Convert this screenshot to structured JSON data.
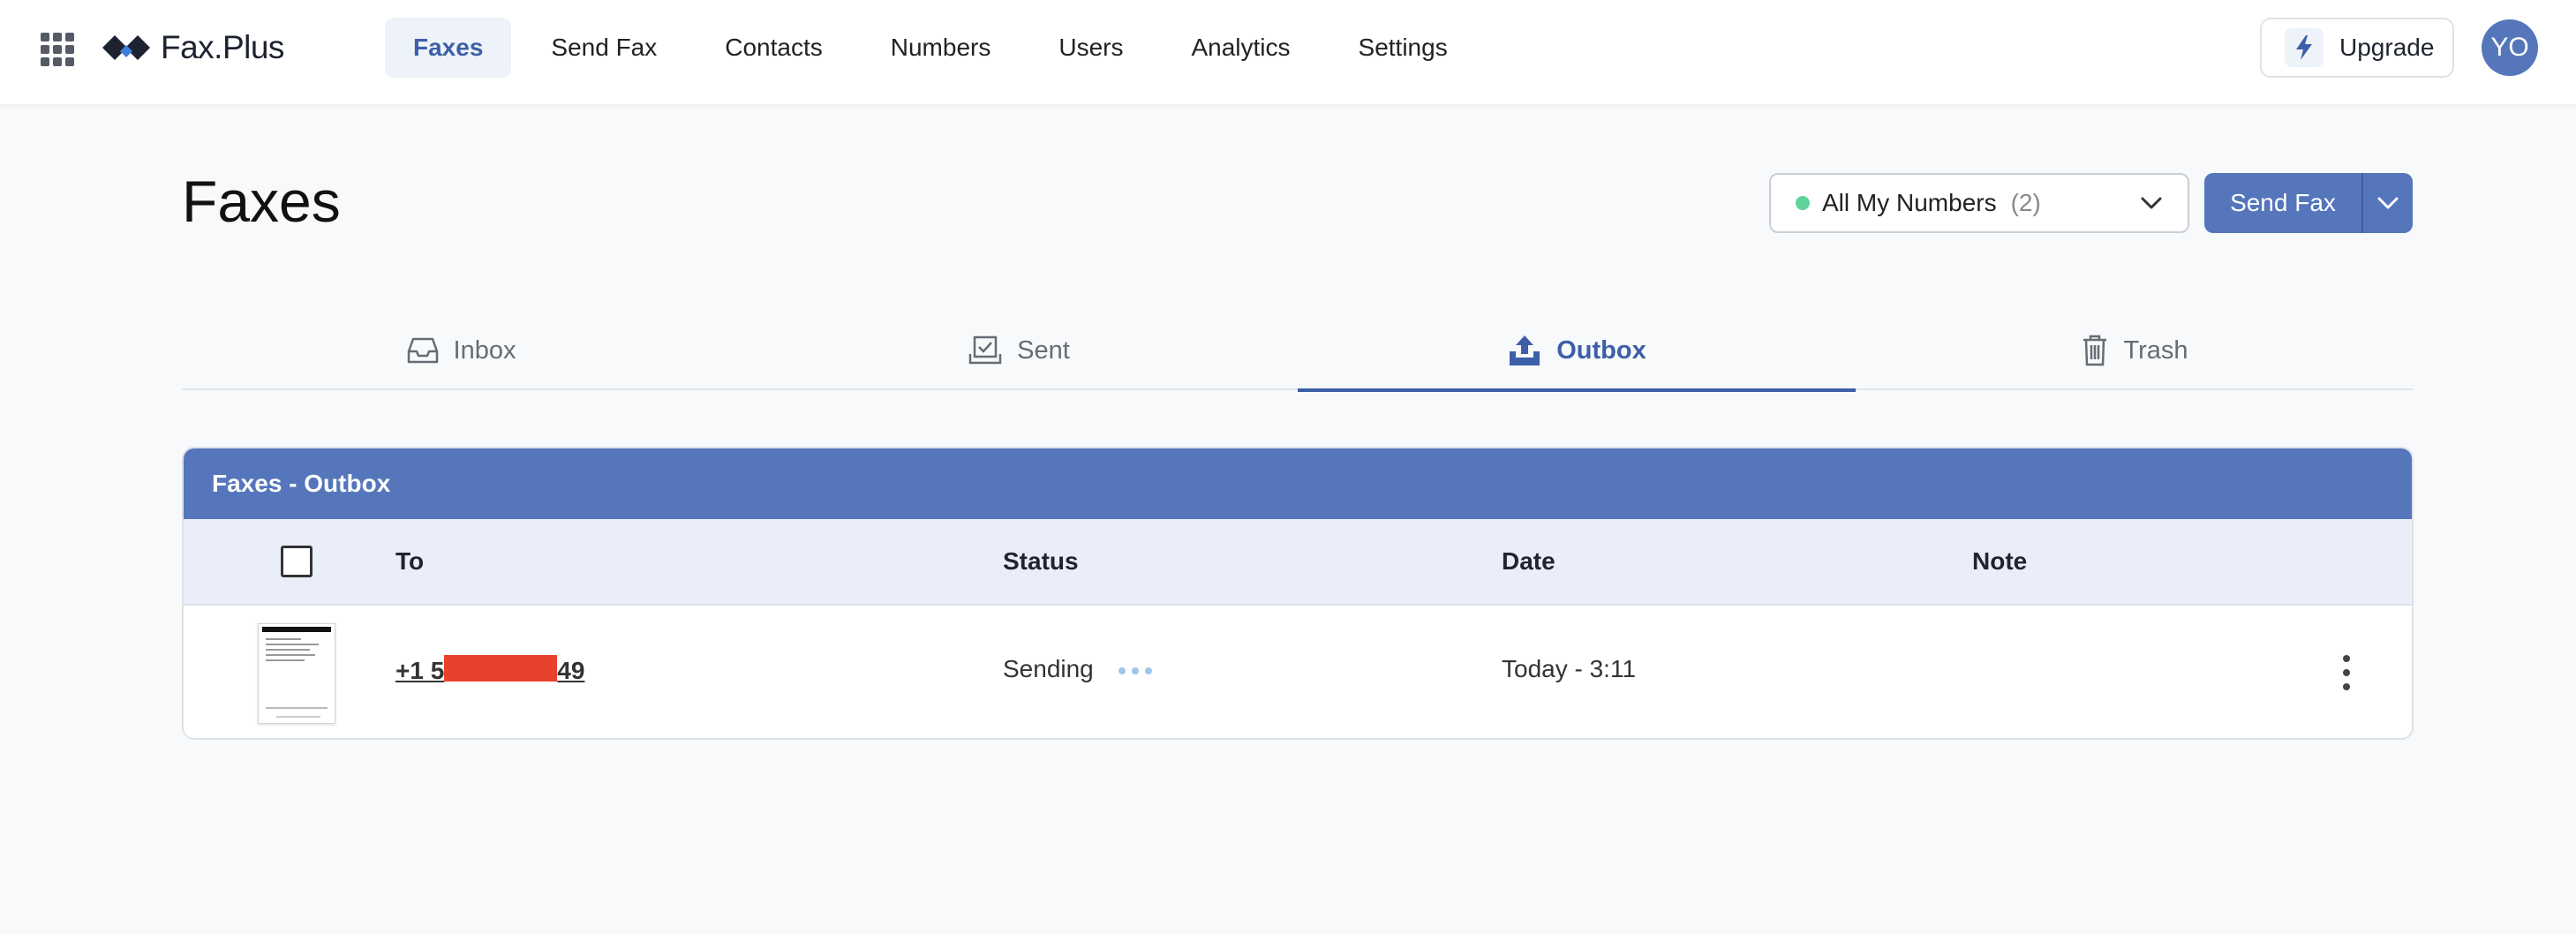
{
  "app": {
    "name": "Fax.Plus"
  },
  "nav": {
    "items": [
      {
        "label": "Faxes",
        "active": true
      },
      {
        "label": "Send Fax",
        "active": false
      },
      {
        "label": "Contacts",
        "active": false
      },
      {
        "label": "Numbers",
        "active": false
      },
      {
        "label": "Users",
        "active": false
      },
      {
        "label": "Analytics",
        "active": false
      },
      {
        "label": "Settings",
        "active": false
      }
    ],
    "upgrade_label": "Upgrade",
    "avatar_initials": "YO"
  },
  "page": {
    "title": "Faxes",
    "number_filter": {
      "label": "All My Numbers",
      "count": "(2)"
    },
    "send_fax_label": "Send Fax"
  },
  "tabs": [
    {
      "label": "Inbox",
      "icon": "inbox-icon",
      "active": false
    },
    {
      "label": "Sent",
      "icon": "sent-icon",
      "active": false
    },
    {
      "label": "Outbox",
      "icon": "upload-icon",
      "active": true
    },
    {
      "label": "Trash",
      "icon": "trash-icon",
      "active": false
    }
  ],
  "table": {
    "title": "Faxes - Outbox",
    "columns": {
      "to": "To",
      "status": "Status",
      "date": "Date",
      "note": "Note"
    },
    "rows": [
      {
        "to_prefix": "+1 5",
        "to_suffix": "49",
        "status": "Sending",
        "date": "Today - 3:11",
        "note": ""
      }
    ]
  },
  "colors": {
    "accent": "#5576bb",
    "accent_dark": "#3d5fa8",
    "status_dot": "#5fd39a",
    "redaction": "#e8412c"
  }
}
